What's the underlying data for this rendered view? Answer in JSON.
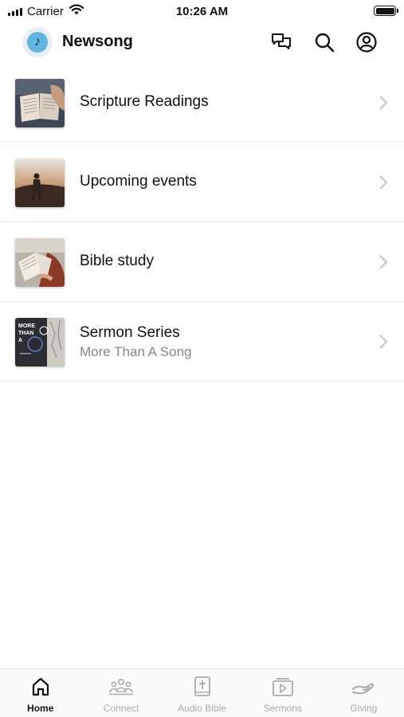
{
  "status_bar": {
    "carrier": "Carrier",
    "time": "10:26 AM"
  },
  "header": {
    "title": "Newsong",
    "logo_glyph": "♪",
    "icons": [
      "chat-icon",
      "search-icon",
      "account-icon"
    ]
  },
  "list": {
    "items": [
      {
        "title": "Scripture Readings",
        "subtitle": "",
        "thumb": "open-bible-photo"
      },
      {
        "title": "Upcoming events",
        "subtitle": "",
        "thumb": "sunset-person-photo"
      },
      {
        "title": "Bible study",
        "subtitle": "",
        "thumb": "reading-book-photo"
      },
      {
        "title": "Sermon Series",
        "subtitle": "More Than A Song",
        "thumb": "more-than-a-song-artwork"
      }
    ],
    "artwork_text": [
      "MORE",
      "THAN",
      "A"
    ]
  },
  "tabbar": {
    "tabs": [
      {
        "label": "Home",
        "icon": "home-icon",
        "active": true
      },
      {
        "label": "Connect",
        "icon": "people-icon",
        "active": false
      },
      {
        "label": "Audio Bible",
        "icon": "bible-icon",
        "active": false
      },
      {
        "label": "Sermons",
        "icon": "play-icon",
        "active": false
      },
      {
        "label": "Giving",
        "icon": "giving-hand-icon",
        "active": false
      }
    ]
  },
  "colors": {
    "accent": "#111111",
    "inactive": "#aaaaaa",
    "logo": "#5fb6e0",
    "divider": "#e9e9e9"
  }
}
